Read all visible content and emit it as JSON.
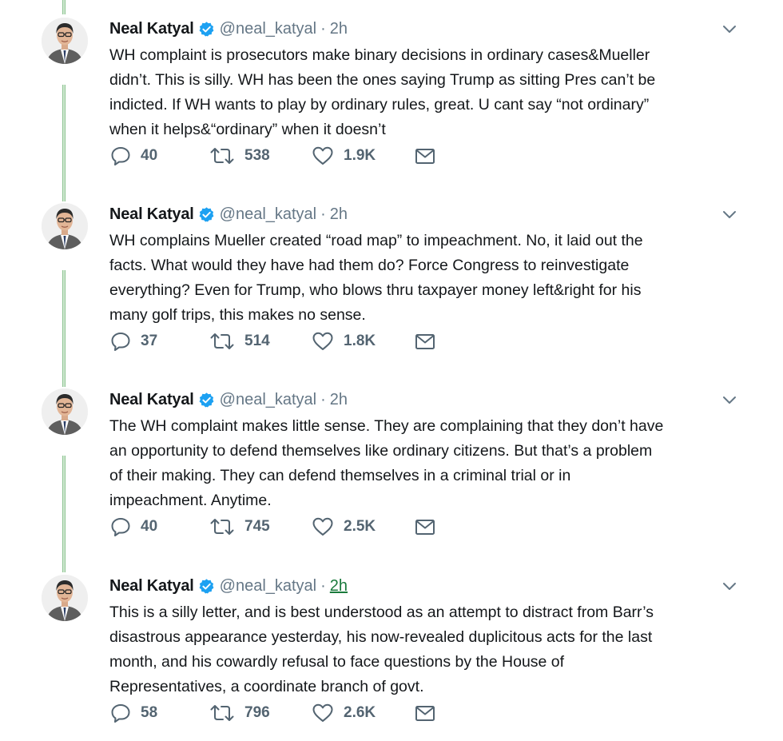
{
  "tweets": [
    {
      "name": "Neal Katyal",
      "handle": "@neal_katyal",
      "separator": "·",
      "time": "2h",
      "lines": [
        "WH complaint is prosecutors make binary decisions in ordinary cases&Mueller",
        "didn’t. This is silly. WH has been the ones saying Trump as sitting Pres can’t be",
        "indicted. If WH wants to play by ordinary rules, great. U cant say “not ordinary”",
        "when it helps&“ordinary” when it doesn’t"
      ],
      "replies": "40",
      "retweets": "538",
      "likes": "1.9K"
    },
    {
      "name": "Neal Katyal",
      "handle": "@neal_katyal",
      "separator": "·",
      "time": "2h",
      "lines": [
        "WH complains Mueller created “road map” to impeachment. No, it laid out the",
        "facts. What would they have had them do? Force Congress to reinvestigate",
        "everything? Even for Trump, who blows thru taxpayer money left&right for his",
        "many golf trips, this makes no sense."
      ],
      "replies": "37",
      "retweets": "514",
      "likes": "1.8K"
    },
    {
      "name": "Neal Katyal",
      "handle": "@neal_katyal",
      "separator": "·",
      "time": "2h",
      "lines": [
        "The WH complaint makes little sense. They are complaining that they don’t have",
        "an opportunity to defend themselves like ordinary citizens. But that’s a problem",
        "of their making. They can defend themselves in a criminal trial or in",
        "impeachment. Anytime."
      ],
      "replies": "40",
      "retweets": "745",
      "likes": "2.5K"
    },
    {
      "name": "Neal Katyal",
      "handle": "@neal_katyal",
      "separator": "·",
      "time": "2h",
      "lines": [
        "This is a silly letter, and is best understood as an attempt to distract from Barr’s",
        "disastrous appearance yesterday, his now-revealed duplicitous acts for the last",
        "month, and his cowardly refusal to face questions by the House of",
        "Representatives, a coordinate branch of govt."
      ],
      "replies": "58",
      "retweets": "796",
      "likes": "2.6K"
    }
  ],
  "icons": {
    "verified": "verified-badge-icon",
    "caret": "chevron-down-icon",
    "reply": "reply-icon",
    "retweet": "retweet-icon",
    "like": "heart-icon",
    "dm": "envelope-icon"
  },
  "colors": {
    "text": "#14171a",
    "muted": "#657786",
    "verified": "#1da1f2",
    "thread_line": "#cfe8d1",
    "time_link": "#1a7a3c"
  }
}
